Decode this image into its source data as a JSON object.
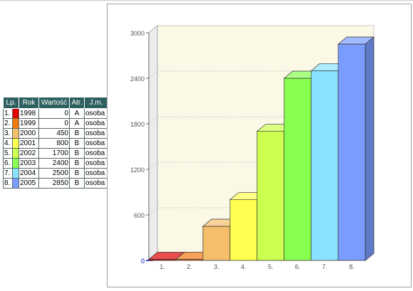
{
  "table": {
    "headers": [
      "Lp.",
      "Rok",
      "Wartość",
      "Atr.",
      "J.m."
    ],
    "rows": [
      {
        "lp": "1.",
        "color": "#e00000",
        "rok": "1998",
        "value": "0",
        "atr": "A",
        "jm": "osoba"
      },
      {
        "lp": "2.",
        "color": "#f07a10",
        "rok": "1999",
        "value": "0",
        "atr": "A",
        "jm": "osoba"
      },
      {
        "lp": "3.",
        "color": "#f5be6a",
        "rok": "2000",
        "value": "450",
        "atr": "B",
        "jm": "osoba"
      },
      {
        "lp": "4.",
        "color": "#ffff50",
        "rok": "2001",
        "value": "800",
        "atr": "B",
        "jm": "osoba"
      },
      {
        "lp": "5.",
        "color": "#ccff50",
        "rok": "2002",
        "value": "1700",
        "atr": "B",
        "jm": "osoba"
      },
      {
        "lp": "6.",
        "color": "#88ff50",
        "rok": "2003",
        "value": "2400",
        "atr": "B",
        "jm": "osoba"
      },
      {
        "lp": "7.",
        "color": "#8ae2ff",
        "rok": "2004",
        "value": "2500",
        "atr": "B",
        "jm": "osoba"
      },
      {
        "lp": "8.",
        "color": "#7a9cff",
        "rok": "2005",
        "value": "2850",
        "atr": "B",
        "jm": "osoba"
      }
    ]
  },
  "chart_data": {
    "type": "bar",
    "categories": [
      "1.",
      "2.",
      "3.",
      "4.",
      "5.",
      "6.",
      "7.",
      "8."
    ],
    "values": [
      0,
      0,
      450,
      800,
      1700,
      2400,
      2500,
      2850
    ],
    "colors": [
      "#e00000",
      "#f07a10",
      "#f5be6a",
      "#ffff50",
      "#ccff50",
      "#88ff50",
      "#8ae2ff",
      "#7a9cff"
    ],
    "ylim": [
      0,
      3000
    ],
    "yticks": [
      "0",
      "600",
      "1200",
      "1800",
      "2400",
      "3000"
    ],
    "grid": true,
    "style": "3d",
    "background": "#fbf8e6"
  }
}
